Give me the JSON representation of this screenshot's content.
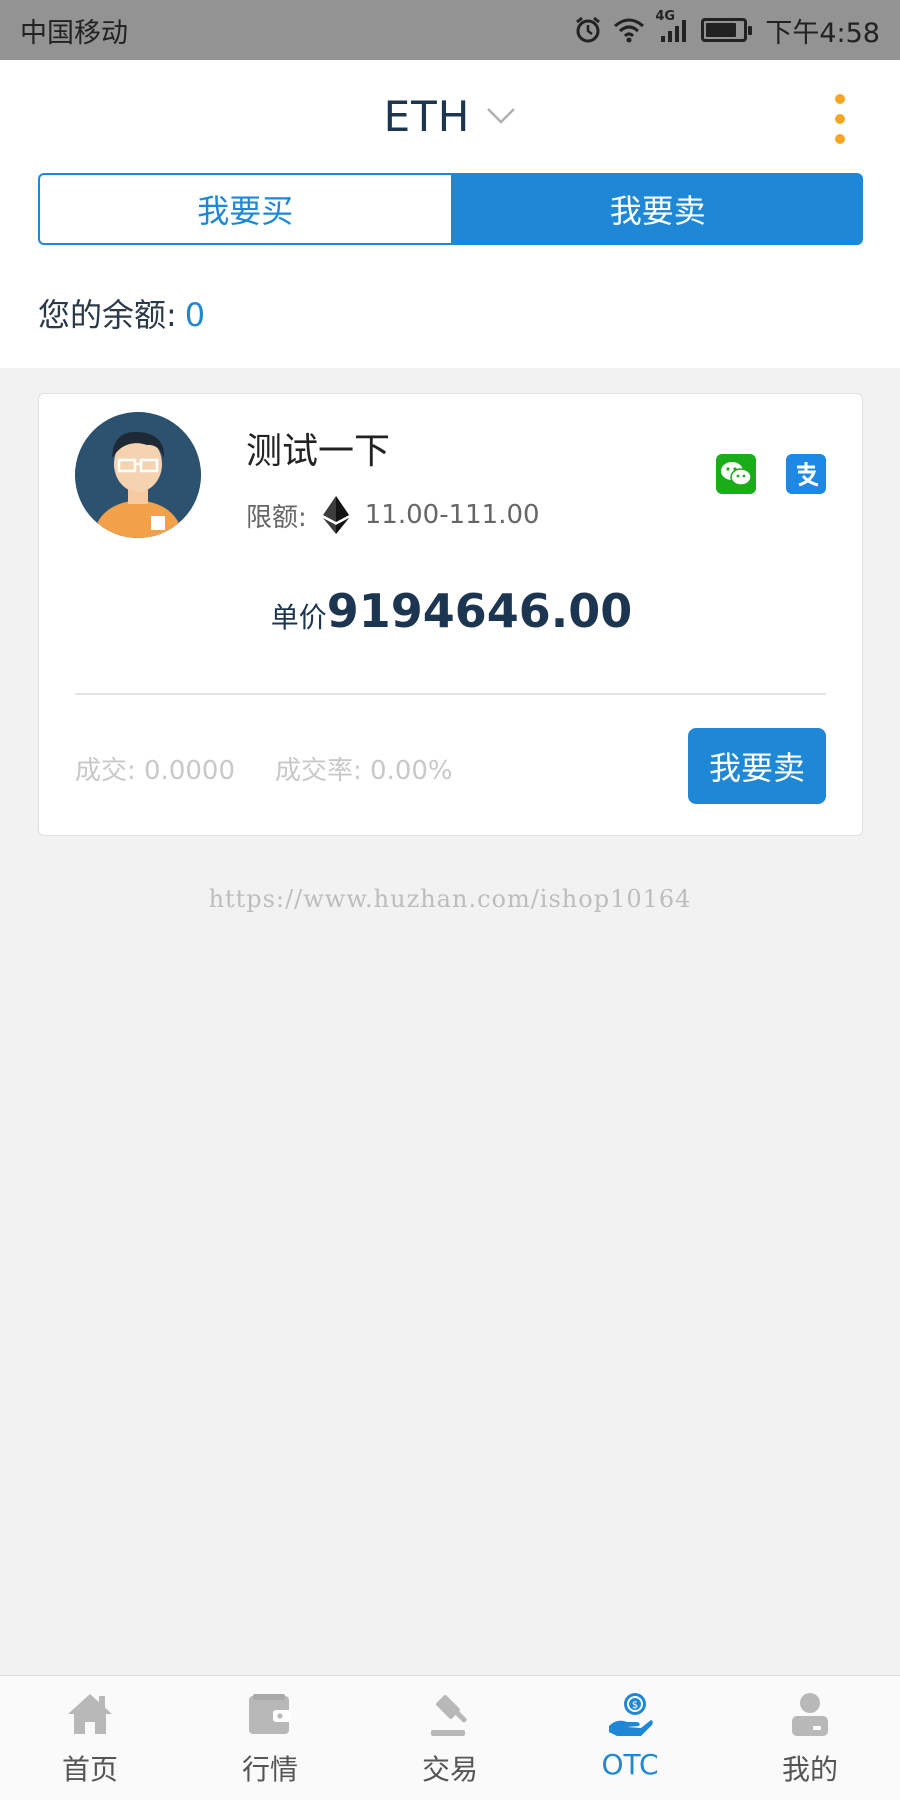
{
  "status_bar": {
    "carrier": "中国移动",
    "network": "4G",
    "time": "下午4:58"
  },
  "header": {
    "coin": "ETH",
    "dropdown_icon": "chevron-down-icon",
    "menu_icon": "more-vertical-icon"
  },
  "segment": {
    "buy_label": "我要买",
    "sell_label": "我要卖",
    "active": "sell"
  },
  "balance": {
    "label": "您的余额:",
    "value": "0"
  },
  "listing": {
    "merchant_name": "测试一下",
    "limit_label": "限额:",
    "limit_value": "11.00-111.00",
    "price_label": "单价",
    "price_value": "9194646.00",
    "volume_text": "成交: 0.0000",
    "rate_text": "成交率: 0.00%",
    "action_label": "我要卖",
    "payment_methods": [
      "wechat-pay-icon",
      "alipay-icon"
    ]
  },
  "watermark": "https://www.huzhan.com/ishop10164",
  "nav": {
    "items": [
      {
        "label": "首页",
        "icon": "home-icon"
      },
      {
        "label": "行情",
        "icon": "wallet-icon"
      },
      {
        "label": "交易",
        "icon": "gavel-icon"
      },
      {
        "label": "OTC",
        "icon": "otc-coin-hand-icon"
      },
      {
        "label": "我的",
        "icon": "user-icon"
      }
    ],
    "active_index": 3
  },
  "colors": {
    "accent": "#1f88d6",
    "menu_dots": "#f5a623",
    "wechat": "#1aad19",
    "alipay": "#1e88e5"
  }
}
